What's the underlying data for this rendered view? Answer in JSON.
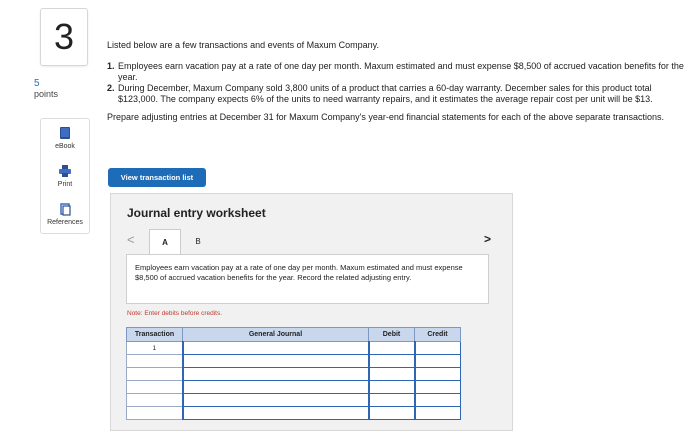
{
  "question": {
    "number": "3",
    "points_value": "5",
    "points_label": "points"
  },
  "tools": [
    {
      "label": "eBook",
      "icon": "book-icon"
    },
    {
      "label": "Print",
      "icon": "printer-icon"
    },
    {
      "label": "References",
      "icon": "references-icon"
    }
  ],
  "intro": "Listed below are a few transactions and events of Maxum Company.",
  "items": [
    {
      "num": "1.",
      "text": "Employees earn vacation pay at a rate of one day per month. Maxum estimated and must expense $8,500 of accrued vacation benefits for the year."
    },
    {
      "num": "2.",
      "text": "During December, Maxum Company sold 3,800 units of a product that carries a 60-day warranty. December sales for this product total $123,000. The company expects 6% of the units to need warranty repairs, and it estimates the average repair cost per unit will be $13."
    }
  ],
  "prepare_text": "Prepare adjusting entries at December 31 for Maxum Company's year-end financial statements for each of the above separate transactions.",
  "view_button": "View transaction list",
  "worksheet": {
    "title": "Journal entry worksheet",
    "prev": "<",
    "next": ">",
    "tabs": [
      "A",
      "B"
    ],
    "description": "Employees earn vacation pay at a rate of one day per month. Maxum estimated and must expense $8,500 of accrued vacation benefits for the year. Record the related adjusting entry.",
    "note": "Note: Enter debits before credits.",
    "table": {
      "headers": [
        "Transaction",
        "General Journal",
        "Debit",
        "Credit"
      ],
      "rows": [
        {
          "transaction": "1"
        },
        {
          "transaction": ""
        },
        {
          "transaction": ""
        },
        {
          "transaction": ""
        },
        {
          "transaction": ""
        },
        {
          "transaction": ""
        }
      ]
    }
  }
}
